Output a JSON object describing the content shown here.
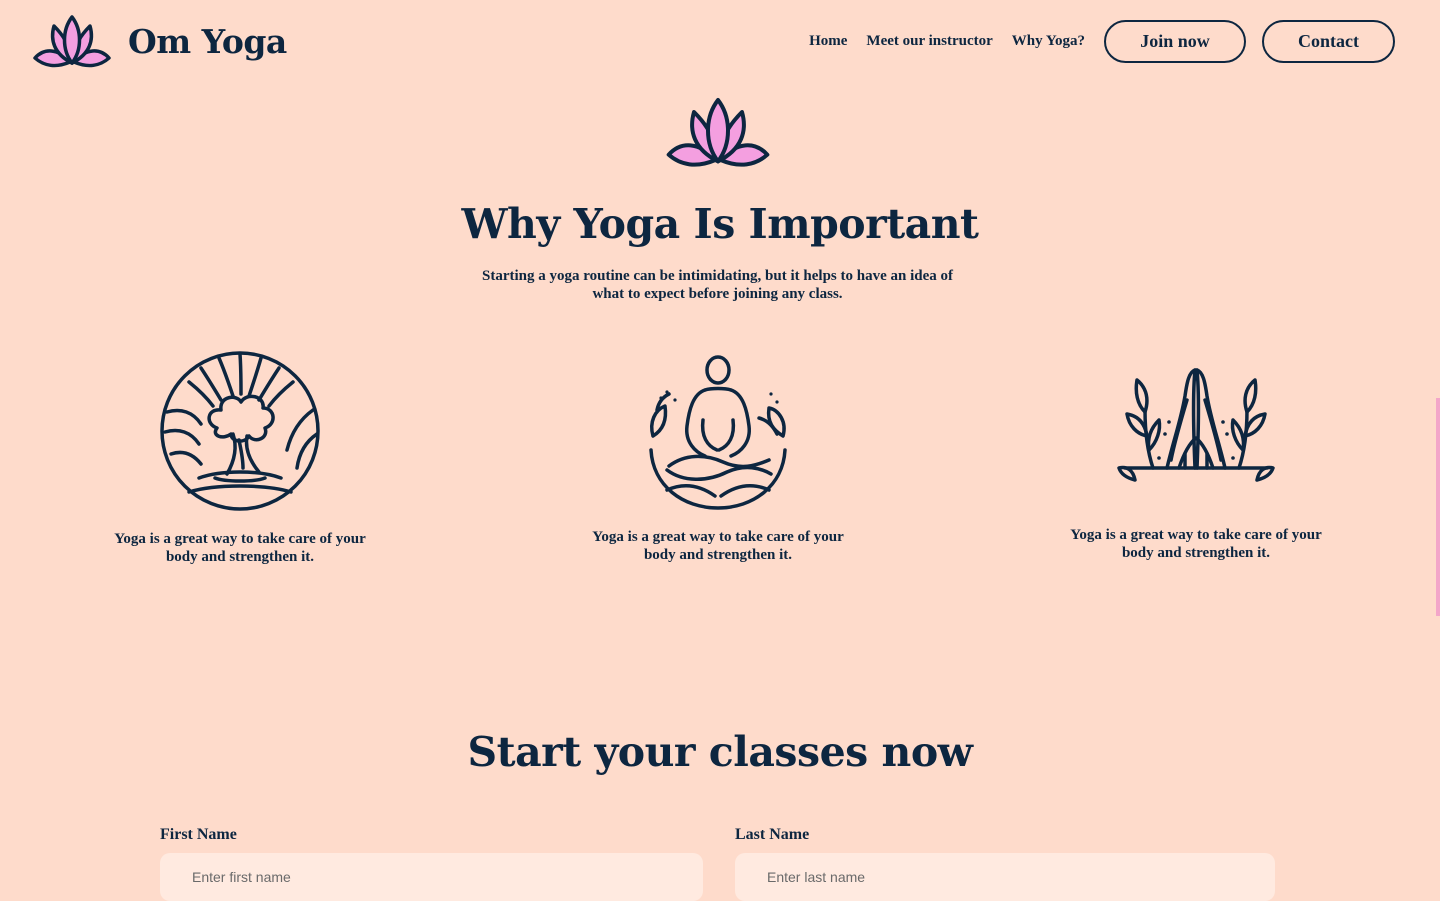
{
  "header": {
    "brand_name": "Om Yoga",
    "logo_icon": "lotus-icon",
    "nav": [
      {
        "label": "Home"
      },
      {
        "label": "Meet our instructor"
      },
      {
        "label": "Why Yoga?"
      }
    ],
    "join_label": "Join now",
    "contact_label": "Contact"
  },
  "why": {
    "icon": "lotus-icon",
    "title": "Why Yoga Is Important",
    "subtitle": "Starting a yoga routine can be intimidating, but it helps to have an idea of what to expect before joining any class.",
    "features": [
      {
        "icon": "tree-circle-icon",
        "text": "Yoga is a great way to take care of your body and strengthen it."
      },
      {
        "icon": "meditation-pose-icon",
        "text": "Yoga is a great way to take care of your body and strengthen it."
      },
      {
        "icon": "praying-hands-icon",
        "text": "Yoga is a great way to take care of your body and strengthen it."
      }
    ]
  },
  "signup": {
    "title": "Start your classes now",
    "first_name": {
      "label": "First Name",
      "placeholder": "Enter first name",
      "value": ""
    },
    "last_name": {
      "label": "Last Name",
      "placeholder": "Enter last name",
      "value": ""
    }
  },
  "colors": {
    "background": "#fedbcb",
    "text": "#0d2640",
    "accent_pink": "#f49fe0",
    "input_bg": "#ffeae0"
  }
}
